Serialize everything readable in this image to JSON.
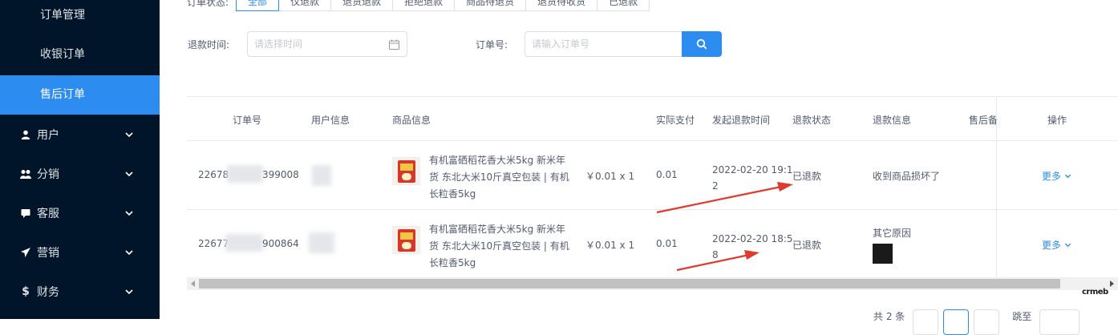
{
  "sidebar": {
    "sub_items": [
      {
        "label": "订单管理"
      },
      {
        "label": "收银订单"
      },
      {
        "label": "售后订单"
      }
    ],
    "menu_items": [
      {
        "label": "用户",
        "icon": "user-icon"
      },
      {
        "label": "分销",
        "icon": "distribution-icon"
      },
      {
        "label": "客服",
        "icon": "chat-icon"
      },
      {
        "label": "营销",
        "icon": "send-icon"
      },
      {
        "label": "财务",
        "icon": "dollar-icon"
      }
    ]
  },
  "filters": {
    "status_options": [
      "全部",
      "仅退款",
      "退货退款",
      "拒绝退款",
      "商品待退货",
      "退货待收货",
      "已退款"
    ],
    "active_status": "全部",
    "refund_time_label": "退款时间:",
    "refund_time_placeholder": "请选择时间",
    "order_no_label": "订单号:",
    "order_no_placeholder": "请输入订单号"
  },
  "table": {
    "headers": {
      "order_no": "订单号",
      "user_info": "用户信息",
      "product_info": "商品信息",
      "actual_paid": "实际支付",
      "refund_time": "发起退款时间",
      "refund_status": "退款状态",
      "refund_info": "退款信息",
      "after_sale_note": "售后备",
      "actions": "操作"
    },
    "rows": [
      {
        "order_prefix": "22678",
        "order_suffix": "399008",
        "product_line1": "有机富硒稻花香大米5kg 新米年",
        "product_line2": "货 东北大米10斤真空包装 | 有机",
        "product_line3": "长粒香5kg",
        "product_price": "￥0.01 x 1",
        "actual_paid": "0.01",
        "refund_time_line1": "2022-02-20 19:1",
        "refund_time_line2": "2",
        "refund_status": "已退款",
        "refund_info": "收到商品损坏了",
        "more_label": "更多"
      },
      {
        "order_prefix": "22677",
        "order_suffix": "900864",
        "product_line1": "有机富硒稻花香大米5kg 新米年",
        "product_line2": "货 东北大米10斤真空包装 | 有机",
        "product_line3": "长粒香5kg",
        "product_price": "￥0.01 x 1",
        "actual_paid": "0.01",
        "refund_time_line1": "2022-02-20 18:5",
        "refund_time_line2": "8",
        "refund_status": "已退款",
        "refund_info": "其它原因",
        "more_label": "更多"
      }
    ]
  },
  "pagination": {
    "total_label": "共 2 条",
    "jump_label": "跳至"
  },
  "watermark": "crmeb",
  "colors": {
    "sidebar_bg": "#001529",
    "primary": "#2d8cf0",
    "annotation_arrow": "#e03a2f"
  }
}
